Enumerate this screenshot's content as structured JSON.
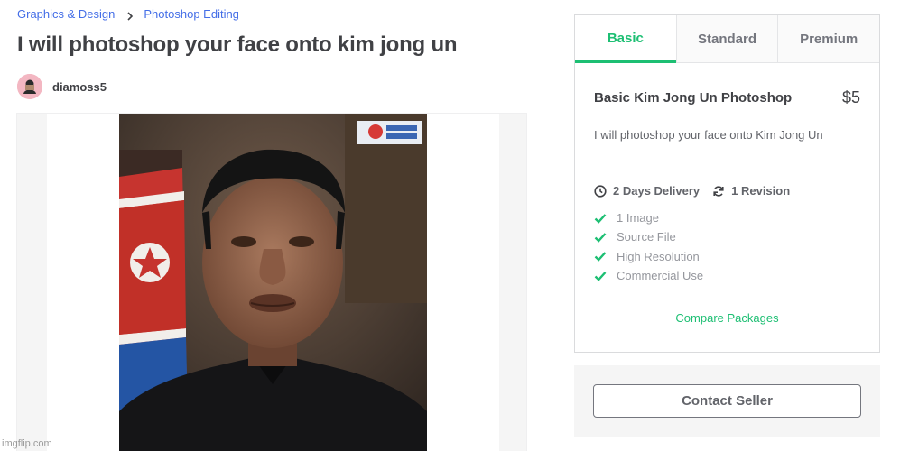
{
  "breadcrumb": {
    "category": "Graphics & Design",
    "subcategory": "Photoshop Editing"
  },
  "gig": {
    "title": "I will photoshop your face onto kim jong un"
  },
  "seller": {
    "username": "diamoss5"
  },
  "gallery": {
    "watermark": "imgflip.com"
  },
  "packages": {
    "tabs": [
      "Basic",
      "Standard",
      "Premium"
    ],
    "active_tab": "Basic",
    "name": "Basic Kim Jong Un Photoshop",
    "price": "$5",
    "description": "I will photoshop your face onto Kim Jong Un",
    "delivery": "2 Days Delivery",
    "revisions": "1 Revision",
    "features": [
      "1 Image",
      "Source File",
      "High Resolution",
      "Commercial Use"
    ],
    "compare_link": "Compare Packages"
  },
  "contact": {
    "label": "Contact Seller"
  },
  "colors": {
    "accent": "#1dbf73",
    "link": "#446ee7",
    "text": "#404145"
  },
  "icons": [
    "chevron-right-icon",
    "clock-icon",
    "refresh-icon",
    "check-icon"
  ]
}
